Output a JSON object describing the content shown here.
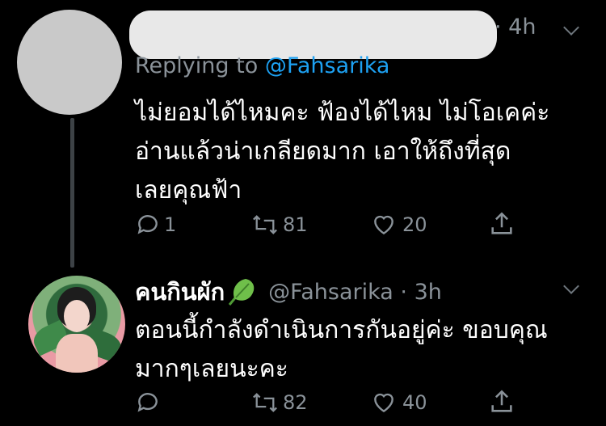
{
  "tweet1": {
    "time": "4h",
    "replying_prefix": "Replying to ",
    "replying_handle": "@Fahsarika",
    "lines": [
      "ไม่ยอมได้ไหมคะ ฟ้องได้ไหม ไม่โอเคค่ะ",
      "อ่านแล้วน่าเกลียดมาก เอาให้ถึงที่สุด",
      "เลยคุณฟ้า"
    ],
    "reply_count": "1",
    "retweet_count": "81",
    "like_count": "20"
  },
  "tweet2": {
    "display_name": "คนกินผัก",
    "handle": "@Fahsarika",
    "time": "3h",
    "lines": [
      "ตอนนี้กำลังดำเนินการกันอยู่ค่ะ ขอบคุณ",
      "มากๆเลยนะคะ"
    ],
    "reply_count": "",
    "retweet_count": "82",
    "like_count": "40"
  },
  "colors": {
    "background": "#000000",
    "muted": "#8a9299",
    "link": "#1da1f2",
    "leaf": "#6fbf4a"
  }
}
